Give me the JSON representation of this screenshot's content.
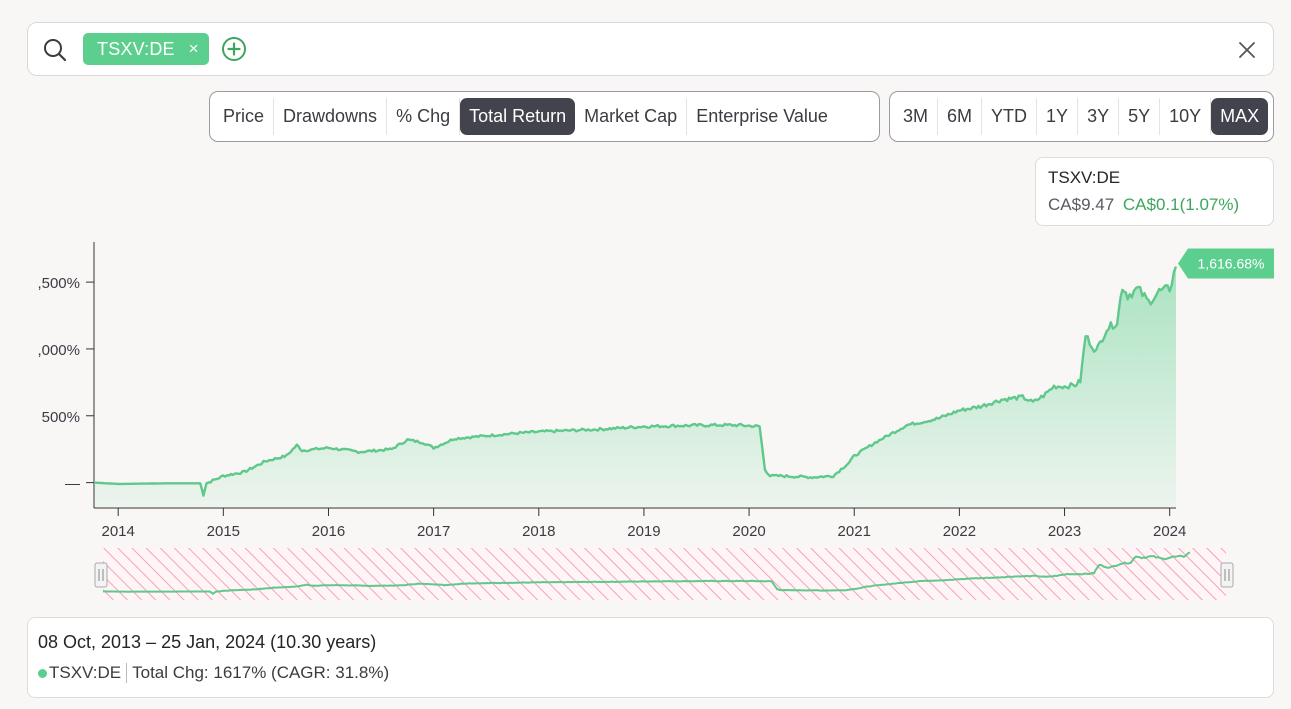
{
  "search": {
    "ticker_chip": "TSXV:DE",
    "chip_close": "×"
  },
  "metric_tabs": [
    {
      "label": "Price",
      "active": false
    },
    {
      "label": "Drawdowns",
      "active": false
    },
    {
      "label": "% Chg",
      "active": false
    },
    {
      "label": "Total Return",
      "active": true
    },
    {
      "label": "Market Cap",
      "active": false
    },
    {
      "label": "Enterprise Value",
      "active": false
    }
  ],
  "range_tabs": [
    {
      "label": "3M",
      "active": false
    },
    {
      "label": "6M",
      "active": false
    },
    {
      "label": "YTD",
      "active": false
    },
    {
      "label": "1Y",
      "active": false
    },
    {
      "label": "3Y",
      "active": false
    },
    {
      "label": "5Y",
      "active": false
    },
    {
      "label": "10Y",
      "active": false
    },
    {
      "label": "MAX",
      "active": true
    }
  ],
  "tooltip": {
    "name": "TSXV:DE",
    "price": "CA$9.47",
    "change": "CA$0.1(1.07%)"
  },
  "summary": {
    "range": "08 Oct, 2013 – 25 Jan, 2024 (10.30 years)",
    "ticker": "TSXV:DE",
    "stat": "Total Chg: 1617% (CAGR: 31.8%)"
  },
  "colors": {
    "accent": "#5ccf8f",
    "line": "#5fc88a",
    "active_tab": "#43434d",
    "positive": "#3ea55f"
  },
  "chart_data": {
    "type": "area",
    "series": [
      {
        "name": "TSXV:DE",
        "x": [
          2013.77,
          2014.0,
          2014.5,
          2014.78,
          2014.81,
          2014.84,
          2015.0,
          2015.2,
          2015.4,
          2015.6,
          2015.7,
          2015.75,
          2016.0,
          2016.3,
          2016.6,
          2016.75,
          2016.9,
          2017.0,
          2017.2,
          2017.5,
          2017.8,
          2018.0,
          2018.3,
          2018.6,
          2018.8,
          2019.0,
          2019.3,
          2019.6,
          2019.9,
          2020.1,
          2020.15,
          2020.2,
          2020.3,
          2020.6,
          2020.8,
          2020.95,
          2021.0,
          2021.2,
          2021.5,
          2021.8,
          2022.0,
          2022.2,
          2022.4,
          2022.6,
          2022.7,
          2022.8,
          2022.9,
          2023.0,
          2023.1,
          2023.15,
          2023.2,
          2023.3,
          2023.4,
          2023.5,
          2023.55,
          2023.6,
          2023.7,
          2023.8,
          2023.9,
          2024.0,
          2024.06
        ],
        "values": [
          0,
          -10,
          -5,
          -5,
          -90,
          -5,
          50,
          80,
          160,
          200,
          280,
          240,
          260,
          230,
          250,
          320,
          300,
          260,
          330,
          350,
          370,
          380,
          390,
          400,
          410,
          420,
          425,
          430,
          430,
          420,
          100,
          50,
          50,
          40,
          50,
          150,
          200,
          300,
          430,
          480,
          540,
          570,
          620,
          640,
          600,
          650,
          720,
          720,
          730,
          760,
          1100,
          980,
          1150,
          1200,
          1470,
          1400,
          1450,
          1350,
          1430,
          1450,
          1616.68
        ]
      }
    ],
    "x_tick_labels": [
      "2014",
      "2015",
      "2016",
      "2017",
      "2018",
      "2019",
      "2020",
      "2021",
      "2022",
      "2023",
      "2024"
    ],
    "y_tick_labels": [
      ",500%",
      ",000%",
      "500%",
      "—"
    ],
    "y_tick_values": [
      1500,
      1000,
      500,
      0
    ],
    "last_value_label": "1,616.68%",
    "xlim": [
      2013.77,
      2024.06
    ],
    "ylim": [
      -190,
      1800
    ],
    "grid": false
  }
}
